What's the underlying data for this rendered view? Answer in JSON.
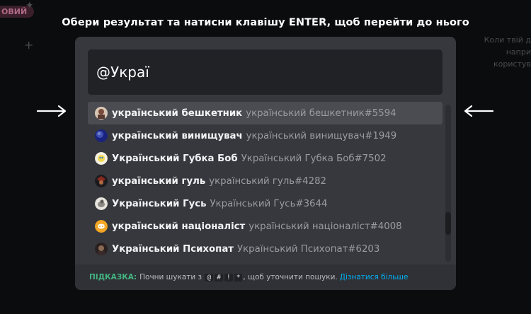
{
  "background": {
    "badge": "ОВИЙ",
    "right_text": [
      "Коли твій д",
      "напри",
      "користув"
    ]
  },
  "title": "Обери результат та натисни клавішу ENTER, щоб перейти до нього",
  "search": {
    "value": "@Украї"
  },
  "results": [
    {
      "name": "український бешкетник",
      "tag": "український бешкетник#5594",
      "avatar": "avatar-bandit-icon",
      "selected": true
    },
    {
      "name": "український винищувач",
      "tag": "український винищувач#1949",
      "avatar": "avatar-globe-icon",
      "selected": false
    },
    {
      "name": "Український Губка Боб",
      "tag": "Український Губка Боб#7502",
      "avatar": "avatar-sponge-icon",
      "selected": false
    },
    {
      "name": "український гуль",
      "tag": "український гуль#4282",
      "avatar": "avatar-ghoul-icon",
      "selected": false
    },
    {
      "name": "Український Гусь",
      "tag": "Український Гусь#3644",
      "avatar": "avatar-goose-icon",
      "selected": false
    },
    {
      "name": "український націоналіст",
      "tag": "український націоналіст#4008",
      "avatar": "avatar-default-icon",
      "selected": false
    },
    {
      "name": "Український Психопат",
      "tag": "Український Психопат#6203",
      "avatar": "avatar-psycho-icon",
      "selected": false
    }
  ],
  "footer": {
    "hint_label": "ПІДКАЗКА:",
    "hint_start": "Почни шукати з",
    "keys": [
      "@",
      "#",
      "!",
      "*"
    ],
    "hint_end": ", щоб уточнити пошуки.",
    "learn_more": "Дізнатися більше"
  },
  "colors": {
    "accent_green": "#43b581",
    "link_blue": "#00aff4",
    "modal_bg": "#36383d"
  }
}
